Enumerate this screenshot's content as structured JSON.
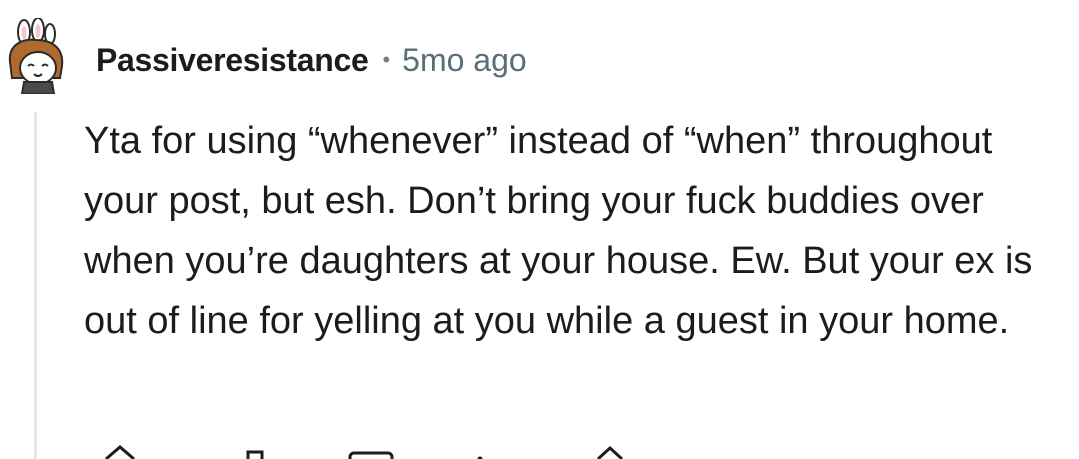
{
  "comment": {
    "author": "Passiveresistance",
    "separator": "•",
    "time_ago": "5mo ago",
    "body": "Yta for using “whenever” instead of “when” throughout your post, but esh. Don’t bring your fuck buddies over when you’re daughters at your house. Ew. But your ex is out of line for yelling at you while a guest in your home."
  },
  "avatar": {
    "icon": "snoo-avatar-icon",
    "bunny_ears_color": "#ffffff",
    "hair_color": "#b06a2e"
  },
  "actions": [
    {
      "icon": "upvote-icon"
    },
    {
      "icon": "downvote-icon"
    },
    {
      "icon": "reply-icon"
    },
    {
      "icon": "more-options-icon"
    },
    {
      "icon": "share-icon"
    }
  ],
  "colors": {
    "text": "#1c1c1c",
    "meta": "#576f76",
    "thread_line": "#e6e6e6"
  }
}
